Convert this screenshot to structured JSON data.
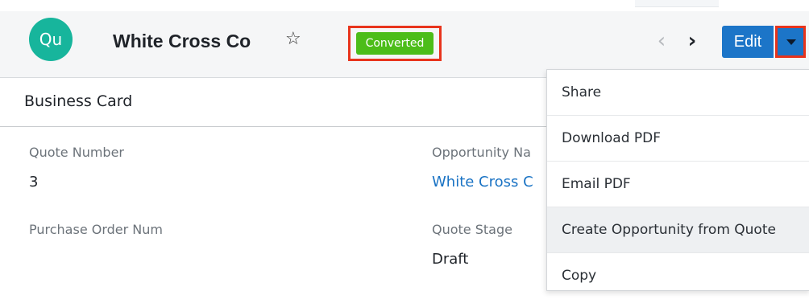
{
  "record": {
    "avatar_text": "Qu",
    "title": "White Cross Co",
    "status": "Converted",
    "edit_label": "Edit"
  },
  "icons": {
    "favorite": "star-outline-icon",
    "prev": "chevron-left-icon",
    "next": "chevron-right-icon",
    "actions": "caret-down-icon"
  },
  "colors": {
    "avatar": "#17b59c",
    "status_badge": "#4cbd19",
    "primary_button": "#1c75c8",
    "highlight": "#e8341c",
    "link": "#1a73c4"
  },
  "panel": {
    "title": "Business Card"
  },
  "fields": {
    "quote_number_label": "Quote Number",
    "quote_number_value": "3",
    "purchase_order_label": "Purchase Order Num",
    "opportunity_label": "Opportunity Na",
    "opportunity_value": "White Cross C",
    "quote_stage_label": "Quote Stage",
    "quote_stage_value": "Draft"
  },
  "actions_menu": {
    "items": [
      "Share",
      "Download PDF",
      "Email PDF",
      "Create Opportunity from Quote",
      "Copy"
    ]
  }
}
